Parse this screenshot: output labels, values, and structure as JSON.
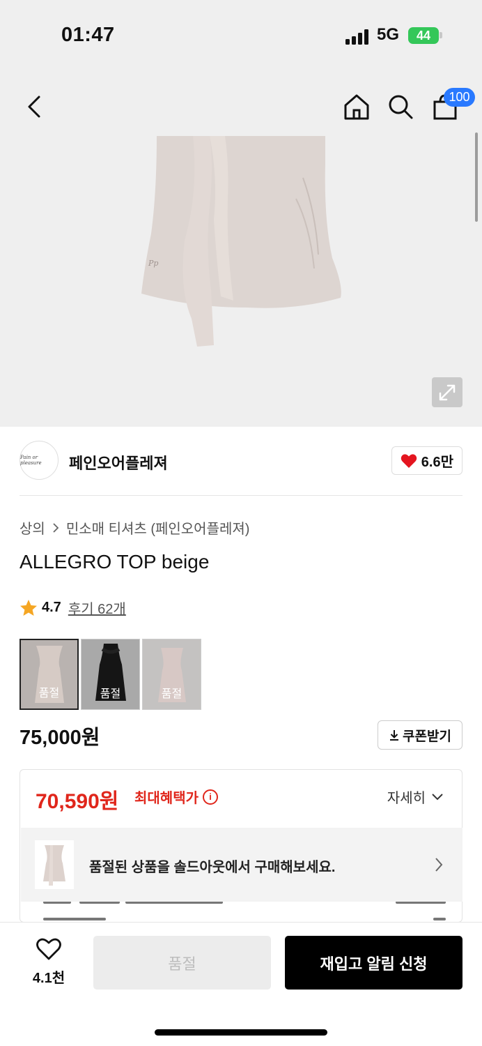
{
  "status_bar": {
    "time": "01:47",
    "network": "5G",
    "battery": "44"
  },
  "nav": {
    "cart_count": "100",
    "icons": [
      "back-icon",
      "home-icon",
      "search-icon",
      "cart-icon"
    ]
  },
  "brand": {
    "name": "페인오어플레져",
    "logo_text": "Pain or pleasure",
    "likes": "6.6만"
  },
  "product": {
    "breadcrumb": [
      "상의",
      "민소매 티셔츠 (페인오어플레져)"
    ],
    "title": "ALLEGRO TOP beige",
    "rating": "4.7",
    "review_label": "후기 62개",
    "swatches": [
      {
        "label": "품절",
        "color": "#c9bfbb"
      },
      {
        "label": "품절",
        "color": "#151515"
      },
      {
        "label": "품절",
        "color": "#d4c5c2"
      }
    ],
    "price": "75,000원",
    "coupon_label": "쿠폰받기"
  },
  "benefit": {
    "price": "70,590원",
    "label": "최대혜택가",
    "info_icon": "i",
    "detail_label": "자세히"
  },
  "soldout_banner": {
    "text": "품절된 상품을 솔드아웃에서 구매해보세요."
  },
  "bottom_bar": {
    "wish_count": "4.1천",
    "soldout_label": "품절",
    "restock_label": "재입고 알림 신청"
  },
  "colors": {
    "accent_red": "#e0261b",
    "badge_blue": "#2979ff",
    "battery_green": "#34c759"
  }
}
